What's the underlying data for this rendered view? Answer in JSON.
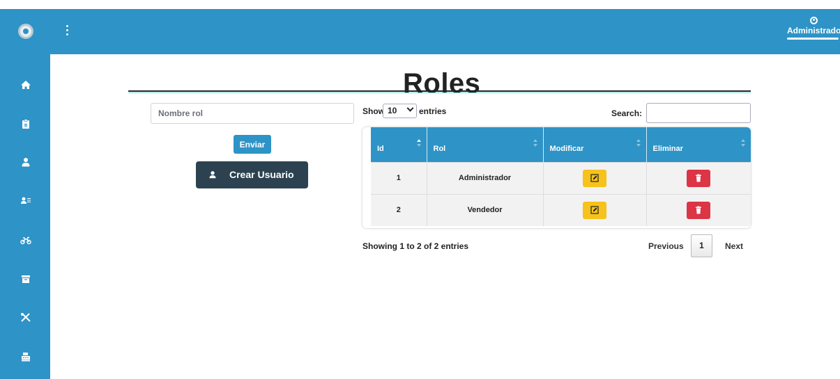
{
  "header": {
    "user_name": "Administrador"
  },
  "sidebar": {
    "icons": [
      "home-icon",
      "clipboard-icon",
      "user-icon",
      "user-list-icon",
      "motorcycle-icon",
      "archive-icon",
      "tools-icon",
      "cash-register-icon"
    ]
  },
  "page": {
    "title": "Roles"
  },
  "form": {
    "input_value": "Nombre rol",
    "submit_label": "Enviar",
    "create_user_label": "Crear Usuario"
  },
  "table": {
    "show_label": "Show",
    "entries_value": "10",
    "entries_label": "entries",
    "search_label": "Search:",
    "columns": [
      "Id",
      "Rol",
      "Modificar",
      "Eliminar"
    ],
    "rows": [
      {
        "id": "1",
        "rol": "Administrador"
      },
      {
        "id": "2",
        "rol": "Vendedor"
      }
    ],
    "info": "Showing 1 to 2 of 2 entries",
    "previous_label": "Previous",
    "page_number": "1",
    "next_label": "Next"
  },
  "colors": {
    "primary": "#2e93c6",
    "dark_button": "#2c4250",
    "edit": "#f7c21b",
    "delete": "#dc3545"
  }
}
